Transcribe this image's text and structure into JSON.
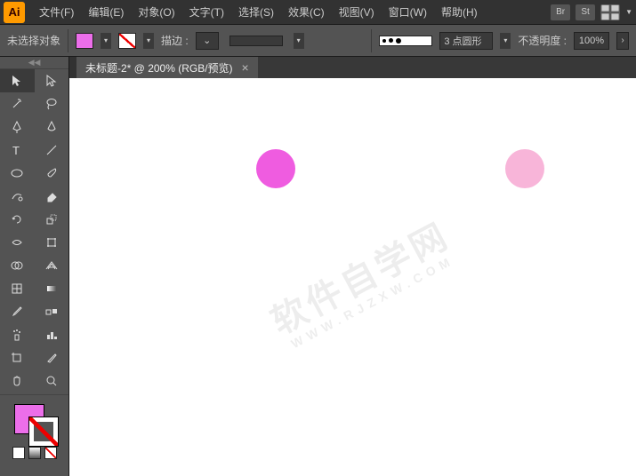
{
  "app": {
    "icon_text": "Ai"
  },
  "menu": {
    "items": [
      "文件(F)",
      "编辑(E)",
      "对象(O)",
      "文字(T)",
      "选择(S)",
      "效果(C)",
      "视图(V)",
      "窗口(W)",
      "帮助(H)"
    ]
  },
  "menubar_right": {
    "br": "Br",
    "st": "St"
  },
  "controlbar": {
    "selection_status": "未选择对象",
    "stroke_label": "描边 :",
    "stroke_profile": "3 点圆形",
    "opacity_label": "不透明度 :",
    "opacity_value": "100%"
  },
  "document": {
    "tab_title": "未标题-2* @ 200% (RGB/预览)"
  },
  "tools": {
    "names": [
      "selection-tool",
      "direct-selection-tool",
      "magic-wand-tool",
      "lasso-tool",
      "pen-tool",
      "curvature-tool",
      "type-tool",
      "line-segment-tool",
      "ellipse-tool",
      "paintbrush-tool",
      "shaper-tool",
      "eraser-tool",
      "rotate-tool",
      "scale-tool",
      "width-tool",
      "free-transform-tool",
      "shape-builder-tool",
      "perspective-grid-tool",
      "mesh-tool",
      "gradient-tool",
      "eyedropper-tool",
      "blend-tool",
      "symbol-sprayer-tool",
      "column-graph-tool",
      "artboard-tool",
      "slice-tool",
      "hand-tool",
      "zoom-tool"
    ]
  },
  "colors": {
    "fill": "#ec6eea",
    "circle1": "#ef5ce0",
    "circle2": "#f8b5d9"
  },
  "watermark": {
    "main": "软件自学网",
    "sub": "WWW.RJZXW.COM"
  }
}
